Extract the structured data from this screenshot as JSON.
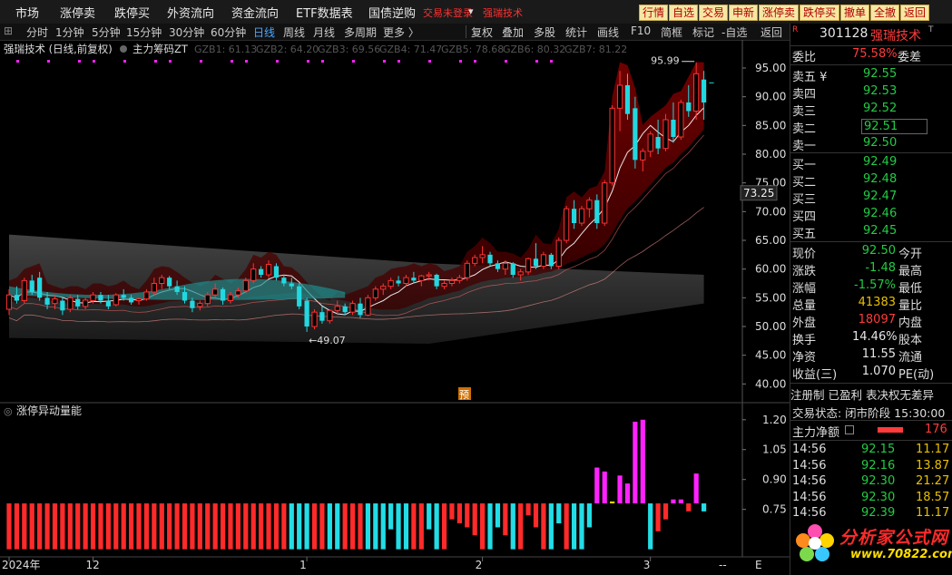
{
  "topbar": {
    "menu": [
      "市场",
      "涨停卖",
      "跌停买",
      "外资流向",
      "资金流向",
      "ETF数据表",
      "国债逆购"
    ],
    "status_text": "交易未登录",
    "stock_short": "强瑞技术",
    "quick_buttons": [
      "行情",
      "自选",
      "交易",
      "申新",
      "涨停卖",
      "跌停买",
      "撤单",
      "全撤",
      "返回"
    ]
  },
  "toolbar": {
    "periods": [
      "分时",
      "1分钟",
      "5分钟",
      "15分钟",
      "30分钟",
      "60分钟",
      "日线",
      "周线",
      "月线",
      "多周期",
      "更多 〉"
    ],
    "active_period": "日线",
    "tools": [
      "复权",
      "叠加",
      "多股",
      "统计",
      "画线",
      "F10",
      "简框",
      "标记",
      "-自选",
      "返回"
    ]
  },
  "main_chart": {
    "title": "强瑞技术 (日线,前复权)",
    "indicator": "主力筹码ZT",
    "legend": [
      {
        "label": "GZB1: 61.13",
        "color": "#9a9a9a"
      },
      {
        "label": "GZB2: 64.20",
        "color": "#9a9a9a"
      },
      {
        "label": "GZB3: 69.56",
        "color": "#9a9a9a"
      },
      {
        "label": "GZB4: 71.47",
        "color": "#9a9a9a"
      },
      {
        "label": "GZB5: 78.68",
        "color": "#9a9a9a"
      },
      {
        "label": "GZB6: 80.32",
        "color": "#9a9a9a"
      },
      {
        "label": "GZB7: 81.22",
        "color": "#9a9a9a"
      }
    ],
    "high_label": "95.99",
    "low_label": "49.07",
    "current_price_label": "73.25",
    "yu_marker": "预",
    "y_ticks": [
      "95.00",
      "90.00",
      "85.00",
      "80.00",
      "75.00",
      "70.00",
      "65.00",
      "60.00",
      "55.00",
      "50.00",
      "45.00",
      "40.00"
    ]
  },
  "sub_chart": {
    "title": "涨停异动量能",
    "y_ticks": [
      "1.20",
      "1.05",
      "0.90",
      "0.75"
    ]
  },
  "x_axis": {
    "labels": [
      "2024年",
      "12",
      "1",
      "2",
      "3"
    ],
    "dashes": "--",
    "end_letter": "E"
  },
  "chart_data": {
    "type": "candlestick",
    "title": "强瑞技术 (日线,前复权)",
    "ylim": [
      38,
      98
    ],
    "candles": [
      {
        "o": 53.0,
        "h": 56.5,
        "l": 52.0,
        "c": 55.5
      },
      {
        "o": 55.5,
        "h": 57.0,
        "l": 54.0,
        "c": 54.5
      },
      {
        "o": 54.5,
        "h": 58.5,
        "l": 54.0,
        "c": 58.0
      },
      {
        "o": 58.0,
        "h": 59.0,
        "l": 55.5,
        "c": 56.0
      },
      {
        "o": 58.5,
        "h": 59.5,
        "l": 54.5,
        "c": 55.0
      },
      {
        "o": 55.0,
        "h": 56.0,
        "l": 53.0,
        "c": 53.8
      },
      {
        "o": 54.0,
        "h": 55.5,
        "l": 53.0,
        "c": 54.8
      },
      {
        "o": 54.5,
        "h": 55.0,
        "l": 52.0,
        "c": 52.8
      },
      {
        "o": 53.0,
        "h": 55.5,
        "l": 52.5,
        "c": 55.0
      },
      {
        "o": 54.8,
        "h": 55.5,
        "l": 53.0,
        "c": 53.5
      },
      {
        "o": 53.5,
        "h": 55.0,
        "l": 53.0,
        "c": 54.6
      },
      {
        "o": 54.5,
        "h": 56.0,
        "l": 54.0,
        "c": 55.5
      },
      {
        "o": 55.5,
        "h": 56.0,
        "l": 54.0,
        "c": 54.5
      },
      {
        "o": 54.5,
        "h": 55.5,
        "l": 53.0,
        "c": 53.5
      },
      {
        "o": 53.8,
        "h": 55.8,
        "l": 53.5,
        "c": 55.5
      },
      {
        "o": 55.5,
        "h": 56.5,
        "l": 54.5,
        "c": 55.0
      },
      {
        "o": 55.0,
        "h": 55.5,
        "l": 53.8,
        "c": 54.2
      },
      {
        "o": 54.5,
        "h": 55.0,
        "l": 53.8,
        "c": 54.8
      },
      {
        "o": 54.8,
        "h": 56.5,
        "l": 54.5,
        "c": 56.0
      },
      {
        "o": 56.0,
        "h": 58.5,
        "l": 55.5,
        "c": 57.5
      },
      {
        "o": 57.5,
        "h": 59.0,
        "l": 56.5,
        "c": 58.5
      },
      {
        "o": 58.5,
        "h": 58.8,
        "l": 56.5,
        "c": 57.0
      },
      {
        "o": 57.0,
        "h": 58.0,
        "l": 55.5,
        "c": 56.0
      },
      {
        "o": 56.0,
        "h": 57.0,
        "l": 54.0,
        "c": 54.5
      },
      {
        "o": 54.5,
        "h": 55.0,
        "l": 52.5,
        "c": 53.2
      },
      {
        "o": 53.5,
        "h": 54.5,
        "l": 52.8,
        "c": 54.0
      },
      {
        "o": 54.0,
        "h": 56.0,
        "l": 53.5,
        "c": 55.5
      },
      {
        "o": 55.5,
        "h": 57.5,
        "l": 55.0,
        "c": 56.5
      },
      {
        "o": 56.5,
        "h": 56.8,
        "l": 53.8,
        "c": 54.5
      },
      {
        "o": 54.5,
        "h": 56.0,
        "l": 54.0,
        "c": 55.5
      },
      {
        "o": 55.5,
        "h": 56.8,
        "l": 55.0,
        "c": 56.2
      },
      {
        "o": 56.2,
        "h": 58.5,
        "l": 55.8,
        "c": 58.0
      },
      {
        "o": 58.0,
        "h": 61.0,
        "l": 57.5,
        "c": 60.0
      },
      {
        "o": 60.0,
        "h": 60.5,
        "l": 58.5,
        "c": 59.0
      },
      {
        "o": 59.0,
        "h": 61.5,
        "l": 58.5,
        "c": 60.8
      },
      {
        "o": 60.5,
        "h": 61.0,
        "l": 58.0,
        "c": 58.5
      },
      {
        "o": 58.5,
        "h": 59.0,
        "l": 57.0,
        "c": 57.5
      },
      {
        "o": 57.5,
        "h": 58.5,
        "l": 56.5,
        "c": 57.0
      },
      {
        "o": 57.0,
        "h": 57.5,
        "l": 53.0,
        "c": 53.5
      },
      {
        "o": 54.5,
        "h": 55.0,
        "l": 49.07,
        "c": 50.0
      },
      {
        "o": 50.0,
        "h": 53.0,
        "l": 49.5,
        "c": 52.5
      },
      {
        "o": 52.5,
        "h": 53.5,
        "l": 50.5,
        "c": 51.0
      },
      {
        "o": 51.0,
        "h": 53.0,
        "l": 50.5,
        "c": 52.8
      },
      {
        "o": 52.8,
        "h": 54.5,
        "l": 52.0,
        "c": 53.5
      },
      {
        "o": 53.5,
        "h": 54.0,
        "l": 52.0,
        "c": 52.5
      },
      {
        "o": 52.5,
        "h": 54.5,
        "l": 52.0,
        "c": 54.0
      },
      {
        "o": 54.0,
        "h": 55.0,
        "l": 51.5,
        "c": 52.0
      },
      {
        "o": 52.0,
        "h": 55.5,
        "l": 51.8,
        "c": 55.0
      },
      {
        "o": 55.0,
        "h": 57.0,
        "l": 54.5,
        "c": 56.5
      },
      {
        "o": 56.5,
        "h": 57.5,
        "l": 55.5,
        "c": 57.0
      },
      {
        "o": 57.0,
        "h": 58.5,
        "l": 56.5,
        "c": 58.0
      },
      {
        "o": 58.0,
        "h": 58.8,
        "l": 57.0,
        "c": 57.5
      },
      {
        "o": 57.5,
        "h": 59.0,
        "l": 57.0,
        "c": 58.5
      },
      {
        "o": 58.5,
        "h": 59.5,
        "l": 57.5,
        "c": 58.0
      },
      {
        "o": 58.0,
        "h": 59.0,
        "l": 57.0,
        "c": 58.8
      },
      {
        "o": 58.8,
        "h": 59.5,
        "l": 58.0,
        "c": 59.0
      },
      {
        "o": 59.0,
        "h": 59.2,
        "l": 56.5,
        "c": 57.0
      },
      {
        "o": 57.0,
        "h": 58.0,
        "l": 56.5,
        "c": 57.5
      },
      {
        "o": 57.5,
        "h": 58.5,
        "l": 57.0,
        "c": 58.0
      },
      {
        "o": 58.0,
        "h": 59.0,
        "l": 57.5,
        "c": 58.5
      },
      {
        "o": 58.5,
        "h": 61.5,
        "l": 58.0,
        "c": 61.0
      },
      {
        "o": 61.0,
        "h": 62.5,
        "l": 60.5,
        "c": 62.0
      },
      {
        "o": 62.0,
        "h": 64.0,
        "l": 61.0,
        "c": 62.5
      },
      {
        "o": 62.5,
        "h": 63.0,
        "l": 60.5,
        "c": 61.0
      },
      {
        "o": 61.0,
        "h": 61.5,
        "l": 59.5,
        "c": 60.0
      },
      {
        "o": 60.0,
        "h": 61.5,
        "l": 59.0,
        "c": 61.0
      },
      {
        "o": 61.0,
        "h": 61.2,
        "l": 58.5,
        "c": 59.0
      },
      {
        "o": 59.0,
        "h": 60.0,
        "l": 58.0,
        "c": 59.5
      },
      {
        "o": 59.5,
        "h": 62.0,
        "l": 59.0,
        "c": 61.8
      },
      {
        "o": 61.8,
        "h": 64.5,
        "l": 60.0,
        "c": 60.5
      },
      {
        "o": 60.5,
        "h": 63.0,
        "l": 60.0,
        "c": 62.5
      },
      {
        "o": 62.5,
        "h": 62.8,
        "l": 60.0,
        "c": 60.5
      },
      {
        "o": 60.5,
        "h": 65.5,
        "l": 60.0,
        "c": 65.0
      },
      {
        "o": 65.0,
        "h": 71.0,
        "l": 64.5,
        "c": 70.5
      },
      {
        "o": 70.5,
        "h": 72.0,
        "l": 67.0,
        "c": 68.0
      },
      {
        "o": 68.0,
        "h": 71.0,
        "l": 67.5,
        "c": 70.5
      },
      {
        "o": 70.5,
        "h": 72.5,
        "l": 69.0,
        "c": 72.0
      },
      {
        "o": 72.0,
        "h": 73.0,
        "l": 67.0,
        "c": 68.0
      },
      {
        "o": 68.0,
        "h": 75.5,
        "l": 67.5,
        "c": 75.0
      },
      {
        "o": 75.0,
        "h": 88.5,
        "l": 74.5,
        "c": 88.0
      },
      {
        "o": 88.0,
        "h": 94.5,
        "l": 84.0,
        "c": 92.0
      },
      {
        "o": 92.0,
        "h": 94.0,
        "l": 86.0,
        "c": 87.0
      },
      {
        "o": 88.0,
        "h": 90.0,
        "l": 77.5,
        "c": 79.0
      },
      {
        "o": 79.0,
        "h": 81.0,
        "l": 77.0,
        "c": 80.5
      },
      {
        "o": 80.5,
        "h": 84.0,
        "l": 79.5,
        "c": 83.5
      },
      {
        "o": 83.0,
        "h": 86.0,
        "l": 80.0,
        "c": 81.0
      },
      {
        "o": 81.0,
        "h": 87.0,
        "l": 80.5,
        "c": 86.0
      },
      {
        "o": 86.0,
        "h": 89.0,
        "l": 82.0,
        "c": 83.0
      },
      {
        "o": 83.0,
        "h": 89.5,
        "l": 82.5,
        "c": 89.0
      },
      {
        "o": 89.0,
        "h": 92.0,
        "l": 86.5,
        "c": 87.5
      },
      {
        "o": 87.5,
        "h": 95.99,
        "l": 86.0,
        "c": 94.0
      },
      {
        "o": 93.0,
        "h": 94.5,
        "l": 86.0,
        "c": 89.0
      },
      {
        "o": 92.5,
        "h": 92.5,
        "l": 92.5,
        "c": 92.5
      }
    ],
    "volume_indicator": {
      "name": "涨停异动量能",
      "baseline": 0.78,
      "bars": [
        {
          "v": 0.55,
          "color": "red"
        },
        {
          "v": 0.55,
          "color": "red"
        },
        {
          "v": 0.55,
          "color": "red"
        },
        {
          "v": 0.55,
          "color": "red"
        },
        {
          "v": 0.55,
          "color": "red"
        },
        {
          "v": 0.55,
          "color": "red"
        },
        {
          "v": 0.55,
          "color": "red"
        },
        {
          "v": 0.55,
          "color": "red"
        },
        {
          "v": 0.55,
          "color": "red"
        },
        {
          "v": 0.55,
          "color": "red"
        },
        {
          "v": 0.55,
          "color": "red"
        },
        {
          "v": 0.55,
          "color": "red"
        },
        {
          "v": 0.55,
          "color": "red"
        },
        {
          "v": 0.55,
          "color": "red"
        },
        {
          "v": 0.55,
          "color": "red"
        },
        {
          "v": 0.55,
          "color": "red"
        },
        {
          "v": 0.55,
          "color": "red"
        },
        {
          "v": 0.55,
          "color": "red"
        },
        {
          "v": 0.55,
          "color": "red"
        },
        {
          "v": 0.55,
          "color": "red"
        },
        {
          "v": 0.55,
          "color": "red"
        },
        {
          "v": 0.55,
          "color": "red"
        },
        {
          "v": 0.55,
          "color": "red"
        },
        {
          "v": 0.55,
          "color": "red"
        },
        {
          "v": 0.55,
          "color": "red"
        },
        {
          "v": 0.55,
          "color": "red"
        },
        {
          "v": 0.55,
          "color": "red"
        },
        {
          "v": 0.55,
          "color": "red"
        },
        {
          "v": 0.55,
          "color": "red"
        },
        {
          "v": 0.55,
          "color": "red"
        },
        {
          "v": 0.55,
          "color": "red"
        },
        {
          "v": 0.55,
          "color": "red"
        },
        {
          "v": 0.55,
          "color": "red"
        },
        {
          "v": 0.55,
          "color": "red"
        },
        {
          "v": 0.55,
          "color": "red"
        },
        {
          "v": 0.55,
          "color": "red"
        },
        {
          "v": 0.55,
          "color": "red"
        },
        {
          "v": 0.55,
          "color": "cyan"
        },
        {
          "v": 0.55,
          "color": "cyan"
        },
        {
          "v": 0.55,
          "color": "cyan"
        },
        {
          "v": 0.55,
          "color": "red"
        },
        {
          "v": 0.55,
          "color": "red"
        },
        {
          "v": 0.55,
          "color": "cyan"
        },
        {
          "v": 0.55,
          "color": "cyan"
        },
        {
          "v": 0.55,
          "color": "red"
        },
        {
          "v": 0.55,
          "color": "red"
        },
        {
          "v": 0.55,
          "color": "red"
        },
        {
          "v": 0.55,
          "color": "cyan"
        },
        {
          "v": 0.55,
          "color": "cyan"
        },
        {
          "v": 0.55,
          "color": "cyan"
        },
        {
          "v": 0.65,
          "color": "cyan"
        },
        {
          "v": 0.55,
          "color": "cyan"
        },
        {
          "v": 0.55,
          "color": "cyan"
        },
        {
          "v": 0.55,
          "color": "red"
        },
        {
          "v": 0.55,
          "color": "red"
        },
        {
          "v": 0.65,
          "color": "cyan"
        },
        {
          "v": 0.55,
          "color": "cyan"
        },
        {
          "v": 0.55,
          "color": "red"
        },
        {
          "v": 0.7,
          "color": "red"
        },
        {
          "v": 0.68,
          "color": "red"
        },
        {
          "v": 0.66,
          "color": "red"
        },
        {
          "v": 0.62,
          "color": "red"
        },
        {
          "v": 0.55,
          "color": "red"
        },
        {
          "v": 0.55,
          "color": "cyan"
        },
        {
          "v": 0.66,
          "color": "cyan"
        },
        {
          "v": 0.62,
          "color": "red"
        },
        {
          "v": 0.55,
          "color": "cyan"
        },
        {
          "v": 0.55,
          "color": "red"
        },
        {
          "v": 0.72,
          "color": "red"
        },
        {
          "v": 0.66,
          "color": "red"
        },
        {
          "v": 0.55,
          "color": "red"
        },
        {
          "v": 0.55,
          "color": "cyan"
        },
        {
          "v": 0.68,
          "color": "cyan"
        },
        {
          "v": 0.55,
          "color": "red"
        },
        {
          "v": 0.55,
          "color": "cyan"
        },
        {
          "v": 0.55,
          "color": "cyan"
        },
        {
          "v": 0.66,
          "color": "cyan"
        },
        {
          "v": 0.96,
          "color": "magenta"
        },
        {
          "v": 0.94,
          "color": "magenta"
        },
        {
          "v": 0.79,
          "color": "yellow"
        },
        {
          "v": 0.92,
          "color": "magenta"
        },
        {
          "v": 0.88,
          "color": "magenta"
        },
        {
          "v": 1.19,
          "color": "magenta"
        },
        {
          "v": 1.2,
          "color": "magenta"
        },
        {
          "v": 0.55,
          "color": "cyan"
        },
        {
          "v": 0.64,
          "color": "red"
        },
        {
          "v": 0.7,
          "color": "red"
        },
        {
          "v": 0.8,
          "color": "magenta"
        },
        {
          "v": 0.8,
          "color": "magenta"
        },
        {
          "v": 0.74,
          "color": "red"
        },
        {
          "v": 0.93,
          "color": "magenta"
        },
        {
          "v": 0.74,
          "color": "cyan"
        }
      ]
    }
  },
  "right_panel": {
    "stock_code": "301128",
    "stock_name": "强瑞技术",
    "weibi_label": "委比",
    "weibi_value": "75.58%",
    "weicha_label": "委差",
    "sell": [
      {
        "label": "卖五 ¥",
        "price": "92.55"
      },
      {
        "label": "卖四",
        "price": "92.53"
      },
      {
        "label": "卖三",
        "price": "92.52"
      },
      {
        "label": "卖二",
        "price": "92.51"
      },
      {
        "label": "卖一",
        "price": "92.50"
      }
    ],
    "buy": [
      {
        "label": "买一",
        "price": "92.49"
      },
      {
        "label": "买二",
        "price": "92.48"
      },
      {
        "label": "买三",
        "price": "92.47"
      },
      {
        "label": "买四",
        "price": "92.46"
      },
      {
        "label": "买五",
        "price": "92.45"
      }
    ],
    "stats": [
      {
        "label": "现价",
        "value": "92.50",
        "color": "green",
        "label2": "今开"
      },
      {
        "label": "涨跌",
        "value": "-1.48",
        "color": "green",
        "label2": "最高"
      },
      {
        "label": "涨幅",
        "value": "-1.57%",
        "color": "green",
        "label2": "最低"
      },
      {
        "label": "总量",
        "value": "41383",
        "color": "yellow",
        "label2": "量比"
      },
      {
        "label": "外盘",
        "value": "18097",
        "color": "red",
        "label2": "内盘"
      },
      {
        "label": "换手",
        "value": "14.46%",
        "color": "white",
        "label2": "股本"
      },
      {
        "label": "净资",
        "value": "11.55",
        "color": "white",
        "label2": "流通"
      },
      {
        "label": "收益(三)",
        "value": "1.070",
        "color": "white",
        "label2": "PE(动)"
      }
    ],
    "tags": "注册制 已盈利 表决权无差异",
    "trade_status": "交易状态: 闭市阶段 15:30:00",
    "net_main_label": "主力净额",
    "net_main_value": "176",
    "ticks": [
      {
        "time": "14:56",
        "price": "92.15",
        "vol": "11.17"
      },
      {
        "time": "14:56",
        "price": "92.16",
        "vol": "13.87"
      },
      {
        "time": "14:56",
        "price": "92.30",
        "vol": "21.27"
      },
      {
        "time": "14:56",
        "price": "92.30",
        "vol": "18.57"
      },
      {
        "time": "14:56",
        "price": "92.39",
        "vol": "11.17"
      }
    ],
    "watermark": "分析家公式网",
    "watermark_url": "www.70822.com"
  },
  "colors": {
    "up": "#ff3333",
    "down": "#22d8e0",
    "magenta": "#ff22ff",
    "yellow": "#e8d000",
    "quick_btn_bg": "#f6e7a3"
  }
}
